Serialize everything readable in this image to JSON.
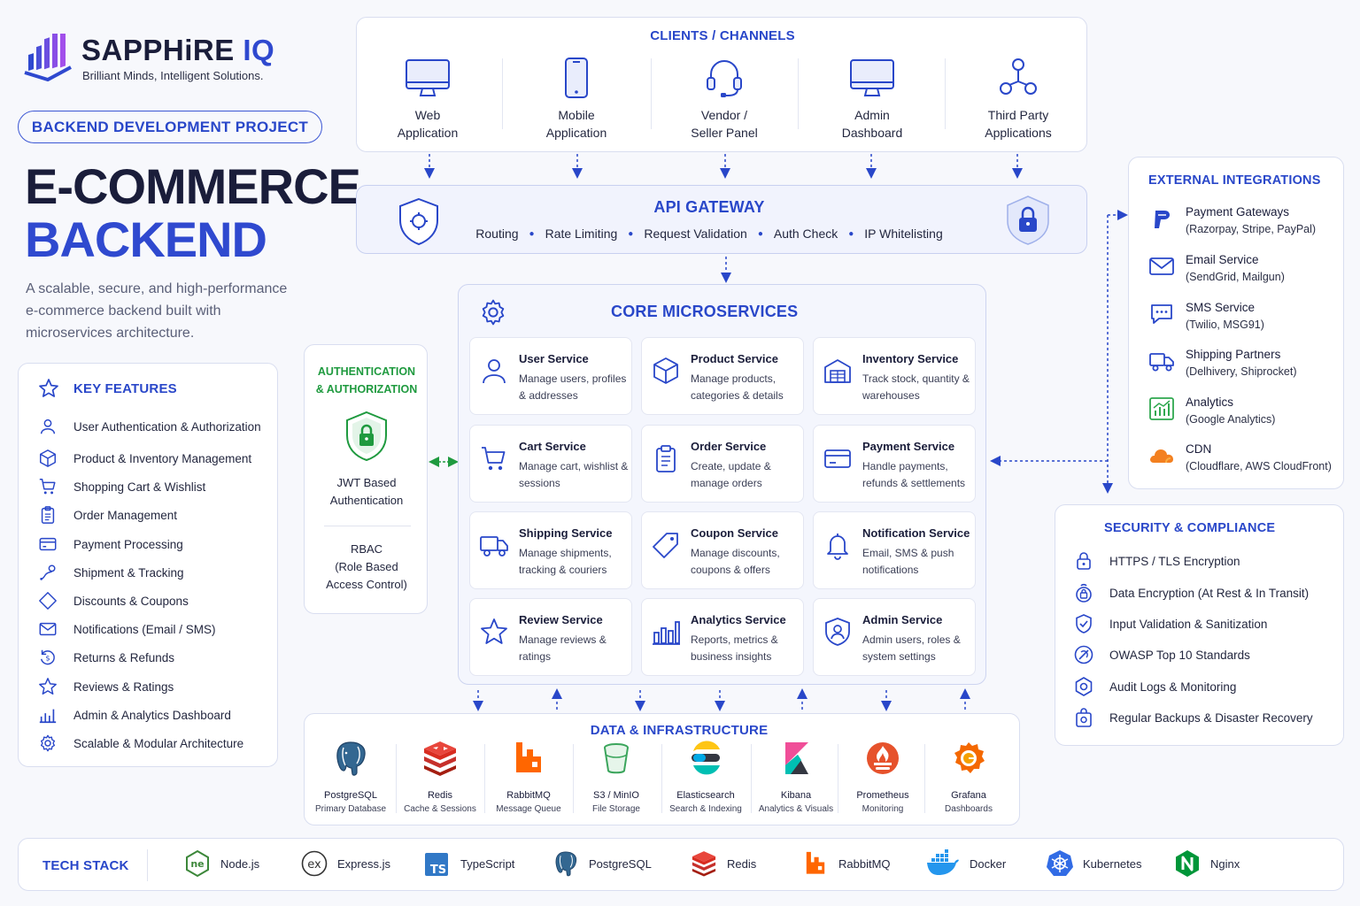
{
  "brand": {
    "name_a": "SAPPHiRE",
    "name_b": "IQ",
    "tagline": "Brilliant Minds, Intelligent Solutions."
  },
  "project_label": "BACKEND DEVELOPMENT PROJECT",
  "title": {
    "line1": "E-COMMERCE",
    "line2": "BACKEND"
  },
  "description": {
    "line1": "A scalable, secure, and high-performance",
    "line2": "e-commerce backend built with",
    "line3": "microservices architecture."
  },
  "key_features": {
    "heading": "KEY FEATURES",
    "items": [
      {
        "label": "User Authentication & Authorization",
        "icon": "user-icon"
      },
      {
        "label": "Product & Inventory Management",
        "icon": "box-icon"
      },
      {
        "label": "Shopping Cart & Wishlist",
        "icon": "cart-icon"
      },
      {
        "label": "Order Management",
        "icon": "clipboard-icon"
      },
      {
        "label": "Payment Processing",
        "icon": "credit-card-icon"
      },
      {
        "label": "Shipment & Tracking",
        "icon": "tracking-icon"
      },
      {
        "label": "Discounts & Coupons",
        "icon": "tag-icon"
      },
      {
        "label": "Notifications (Email / SMS)",
        "icon": "mail-icon"
      },
      {
        "label": "Returns & Refunds",
        "icon": "refund-icon"
      },
      {
        "label": "Reviews & Ratings",
        "icon": "star-icon"
      },
      {
        "label": "Admin & Analytics Dashboard",
        "icon": "bar-chart-icon"
      },
      {
        "label": "Scalable & Modular Architecture",
        "icon": "gear-icon"
      }
    ]
  },
  "clients": {
    "heading": "CLIENTS / CHANNELS",
    "items": [
      {
        "line1": "Web",
        "line2": "Application",
        "icon": "monitor-icon"
      },
      {
        "line1": "Mobile",
        "line2": "Application",
        "icon": "mobile-icon"
      },
      {
        "line1": "Vendor /",
        "line2": "Seller Panel",
        "icon": "headset-icon"
      },
      {
        "line1": "Admin",
        "line2": "Dashboard",
        "icon": "monitor-icon"
      },
      {
        "line1": "Third Party",
        "line2": "Applications",
        "icon": "network-icon"
      }
    ]
  },
  "api_gateway": {
    "heading": "API GATEWAY",
    "features": [
      "Routing",
      "Rate Limiting",
      "Request Validation",
      "Auth Check",
      "IP Whitelisting"
    ]
  },
  "auth": {
    "heading_line1": "AUTHENTICATION",
    "heading_line2": "& AUTHORIZATION",
    "jwt_line1": "JWT Based",
    "jwt_line2": "Authentication",
    "rbac_line1": "RBAC",
    "rbac_line2": "(Role Based",
    "rbac_line3": "Access Control)"
  },
  "core": {
    "heading": "CORE MICROSERVICES",
    "services": [
      {
        "name": "User Service",
        "desc": "Manage users, profiles & addresses",
        "icon": "user-icon"
      },
      {
        "name": "Product Service",
        "desc": "Manage products, categories & details",
        "icon": "box-icon"
      },
      {
        "name": "Inventory Service",
        "desc": "Track stock, quantity & warehouses",
        "icon": "warehouse-icon"
      },
      {
        "name": "Cart Service",
        "desc": "Manage cart, wishlist & sessions",
        "icon": "cart-icon"
      },
      {
        "name": "Order Service",
        "desc": "Create, update & manage orders",
        "icon": "clipboard-icon"
      },
      {
        "name": "Payment Service",
        "desc": "Handle payments, refunds & settlements",
        "icon": "credit-card-icon"
      },
      {
        "name": "Shipping Service",
        "desc": "Manage shipments, tracking & couriers",
        "icon": "truck-icon"
      },
      {
        "name": "Coupon Service",
        "desc": "Manage discounts, coupons & offers",
        "icon": "tag-icon"
      },
      {
        "name": "Notification Service",
        "desc": "Email, SMS & push notifications",
        "icon": "bell-icon"
      },
      {
        "name": "Review Service",
        "desc": "Manage reviews & ratings",
        "icon": "star-icon"
      },
      {
        "name": "Analytics Service",
        "desc": "Reports, metrics & business insights",
        "icon": "bar-chart-icon"
      },
      {
        "name": "Admin Service",
        "desc": "Admin users, roles & system settings",
        "icon": "shield-user-icon"
      }
    ]
  },
  "external": {
    "heading": "EXTERNAL INTEGRATIONS",
    "items": [
      {
        "name": "Payment Gateways",
        "desc": "(Razorpay, Stripe, PayPal)",
        "icon": "payment-gateway-icon",
        "color": "#2947c9"
      },
      {
        "name": "Email Service",
        "desc": "(SendGrid, Mailgun)",
        "icon": "mail-icon",
        "color": "#2947c9"
      },
      {
        "name": "SMS Service",
        "desc": "(Twilio, MSG91)",
        "icon": "sms-icon",
        "color": "#2947c9"
      },
      {
        "name": "Shipping Partners",
        "desc": "(Delhivery, Shiprocket)",
        "icon": "truck-icon",
        "color": "#2947c9"
      },
      {
        "name": "Analytics",
        "desc": "(Google Analytics)",
        "icon": "analytics-icon",
        "color": "#2fa84f"
      },
      {
        "name": "CDN",
        "desc": "(Cloudflare, AWS CloudFront)",
        "icon": "cloud-icon",
        "color": "#f38020"
      }
    ]
  },
  "security": {
    "heading": "SECURITY & COMPLIANCE",
    "items": [
      {
        "label": "HTTPS / TLS Encryption",
        "icon": "lock-icon"
      },
      {
        "label": "Data Encryption (At Rest & In Transit)",
        "icon": "encrypt-lock-icon"
      },
      {
        "label": "Input Validation & Sanitization",
        "icon": "shield-check-icon"
      },
      {
        "label": "OWASP Top 10 Standards",
        "icon": "owasp-icon"
      },
      {
        "label": "Audit Logs & Monitoring",
        "icon": "audit-icon"
      },
      {
        "label": "Regular Backups & Disaster Recovery",
        "icon": "backup-icon"
      }
    ]
  },
  "data_infra": {
    "heading": "DATA & INFRASTRUCTURE",
    "items": [
      {
        "name": "PostgreSQL",
        "desc": "Primary Database",
        "icon": "postgresql-icon",
        "color": "#336791"
      },
      {
        "name": "Redis",
        "desc": "Cache & Sessions",
        "icon": "redis-icon",
        "color": "#d82c20"
      },
      {
        "name": "RabbitMQ",
        "desc": "Message Queue",
        "icon": "rabbitmq-icon",
        "color": "#ff6600"
      },
      {
        "name": "S3 / MinIO",
        "desc": "File Storage",
        "icon": "bucket-icon",
        "color": "#3ba55c"
      },
      {
        "name": "Elasticsearch",
        "desc": "Search & Indexing",
        "icon": "elasticsearch-icon",
        "color": "#00bfb3"
      },
      {
        "name": "Kibana",
        "desc": "Analytics & Visuals",
        "icon": "kibana-icon",
        "color": "#e8478b"
      },
      {
        "name": "Prometheus",
        "desc": "Monitoring",
        "icon": "prometheus-icon",
        "color": "#e6522c"
      },
      {
        "name": "Grafana",
        "desc": "Dashboards",
        "icon": "grafana-icon",
        "color": "#f46800"
      }
    ]
  },
  "tech_stack": {
    "heading": "TECH STACK",
    "items": [
      {
        "label": "Node.js",
        "icon": "nodejs-icon",
        "color": "#3c873a"
      },
      {
        "label": "Express.js",
        "icon": "express-icon",
        "color": "#333333"
      },
      {
        "label": "TypeScript",
        "icon": "typescript-icon",
        "color": "#3178c6"
      },
      {
        "label": "PostgreSQL",
        "icon": "postgresql-icon",
        "color": "#336791"
      },
      {
        "label": "Redis",
        "icon": "redis-icon",
        "color": "#d82c20"
      },
      {
        "label": "RabbitMQ",
        "icon": "rabbitmq-icon",
        "color": "#ff6600"
      },
      {
        "label": "Docker",
        "icon": "docker-icon",
        "color": "#2496ed"
      },
      {
        "label": "Kubernetes",
        "icon": "kubernetes-icon",
        "color": "#326ce5"
      },
      {
        "label": "Nginx",
        "icon": "nginx-icon",
        "color": "#009639"
      }
    ]
  },
  "colors": {
    "accent": "#2947c9",
    "heading": "#1a1d3a",
    "auth": "#1f9a3f",
    "border": "#d9def0"
  }
}
